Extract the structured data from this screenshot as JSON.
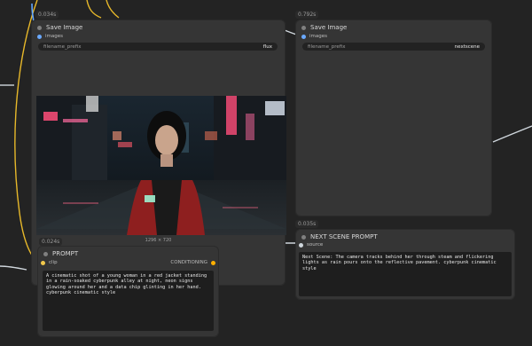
{
  "colors": {
    "canvas_bg": "#232323",
    "node_bg": "#353535",
    "wire_yellow": "#e7b82a",
    "wire_white": "#cfd6dc",
    "wire_blue": "#61a6ff",
    "socket_images": "#6aa9ff",
    "socket_clip": "#f2c94c",
    "socket_conditioning": "#ffb000"
  },
  "nodes": {
    "save_left": {
      "time": "0.034s",
      "title": "Save Image",
      "input_label": "images",
      "widget_label": "filename_prefix",
      "widget_value": "flux",
      "image_caption": "1296 × 720"
    },
    "save_right": {
      "time": "0.792s",
      "title": "Save Image",
      "input_label": "images",
      "widget_label": "filename_prefix",
      "widget_value": "nextscene"
    },
    "prompt": {
      "time": "0.024s",
      "title": "PROMPT",
      "input_label": "clip",
      "output_label": "CONDITIONING",
      "text": "A cinematic shot of a young woman in a red jacket standing in a rain-soaked cyberpunk alley at night, neon signs glowing around her and a data chip glinting in her hand. cyberpunk cinematic style"
    },
    "next_scene": {
      "time": "0.035s",
      "title": "NEXT SCENE PROMPT",
      "input_label": "source",
      "text": "Next Scene: The camera tracks behind her through steam and flickering lights as rain pours onto the reflective pavement. cyberpunk cinematic style"
    }
  }
}
